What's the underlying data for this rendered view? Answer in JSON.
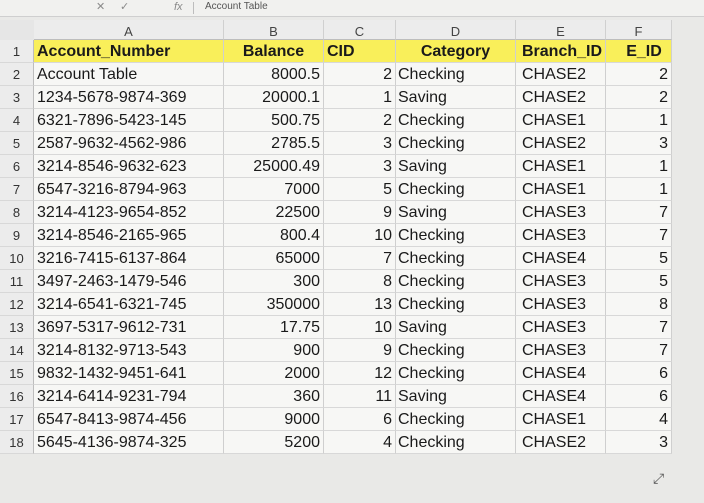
{
  "formula_bar": {
    "cancel": "✕",
    "confirm": "✓",
    "fx": "fx",
    "content": "Account Table"
  },
  "columns": [
    "A",
    "B",
    "C",
    "D",
    "E",
    "F"
  ],
  "row_numbers": [
    "1",
    "2",
    "3",
    "4",
    "5",
    "6",
    "7",
    "8",
    "9",
    "10",
    "11",
    "12",
    "13",
    "14",
    "15",
    "16",
    "17",
    "18"
  ],
  "header": [
    "Account_Number",
    "Balance",
    "CID",
    "Category",
    "Branch_ID",
    "E_ID"
  ],
  "rows": [
    {
      "a": "Account Table",
      "b": "8000.5",
      "c": "2",
      "d": "Checking",
      "e": "CHASE2",
      "f": "2"
    },
    {
      "a": "1234-5678-9874-369",
      "b": "20000.1",
      "c": "1",
      "d": "Saving",
      "e": "CHASE2",
      "f": "2"
    },
    {
      "a": "6321-7896-5423-145",
      "b": "500.75",
      "c": "2",
      "d": "Checking",
      "e": "CHASE1",
      "f": "1"
    },
    {
      "a": "2587-9632-4562-986",
      "b": "2785.5",
      "c": "3",
      "d": "Checking",
      "e": "CHASE2",
      "f": "3"
    },
    {
      "a": "3214-8546-9632-623",
      "b": "25000.49",
      "c": "3",
      "d": "Saving",
      "e": "CHASE1",
      "f": "1"
    },
    {
      "a": "6547-3216-8794-963",
      "b": "7000",
      "c": "5",
      "d": "Checking",
      "e": "CHASE1",
      "f": "1"
    },
    {
      "a": "3214-4123-9654-852",
      "b": "22500",
      "c": "9",
      "d": "Saving",
      "e": "CHASE3",
      "f": "7"
    },
    {
      "a": "3214-8546-2165-965",
      "b": "800.4",
      "c": "10",
      "d": "Checking",
      "e": "CHASE3",
      "f": "7"
    },
    {
      "a": "3216-7415-6137-864",
      "b": "65000",
      "c": "7",
      "d": "Checking",
      "e": "CHASE4",
      "f": "5"
    },
    {
      "a": "3497-2463-1479-546",
      "b": "300",
      "c": "8",
      "d": "Checking",
      "e": "CHASE3",
      "f": "5"
    },
    {
      "a": "3214-6541-6321-745",
      "b": "350000",
      "c": "13",
      "d": "Checking",
      "e": "CHASE3",
      "f": "8"
    },
    {
      "a": "3697-5317-9612-731",
      "b": "17.75",
      "c": "10",
      "d": "Saving",
      "e": "CHASE3",
      "f": "7"
    },
    {
      "a": "3214-8132-9713-543",
      "b": "900",
      "c": "9",
      "d": "Checking",
      "e": "CHASE3",
      "f": "7"
    },
    {
      "a": "9832-1432-9451-641",
      "b": "2000",
      "c": "12",
      "d": "Checking",
      "e": "CHASE4",
      "f": "6"
    },
    {
      "a": "3214-6414-9231-794",
      "b": "360",
      "c": "11",
      "d": "Saving",
      "e": "CHASE4",
      "f": "6"
    },
    {
      "a": "6547-8413-9874-456",
      "b": "9000",
      "c": "6",
      "d": "Checking",
      "e": "CHASE1",
      "f": "4"
    },
    {
      "a": "5645-4136-9874-325",
      "b": "5200",
      "c": "4",
      "d": "Checking",
      "e": "CHASE2",
      "f": "3"
    }
  ],
  "resize_glyph": "⤢"
}
